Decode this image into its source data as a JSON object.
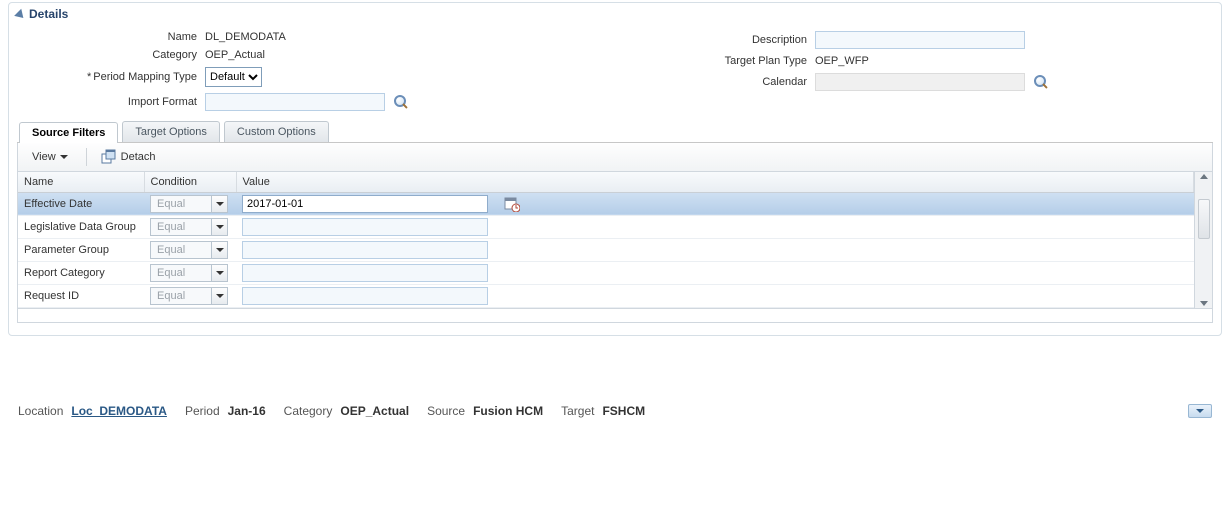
{
  "panel": {
    "title": "Details"
  },
  "form": {
    "left": {
      "name_label": "Name",
      "name_value": "DL_DEMODATA",
      "category_label": "Category",
      "category_value": "OEP_Actual",
      "period_mapping_label": "Period Mapping Type",
      "period_mapping_required": "*",
      "period_mapping_value": "Default",
      "import_format_label": "Import Format",
      "import_format_value": ""
    },
    "right": {
      "description_label": "Description",
      "description_value": "",
      "target_plan_type_label": "Target Plan Type",
      "target_plan_type_value": "OEP_WFP",
      "calendar_label": "Calendar",
      "calendar_value": ""
    }
  },
  "tabs": {
    "source_filters": "Source Filters",
    "target_options": "Target Options",
    "custom_options": "Custom Options"
  },
  "toolbar": {
    "view_label": "View",
    "detach_label": "Detach"
  },
  "grid": {
    "headers": {
      "name": "Name",
      "condition": "Condition",
      "value": "Value"
    },
    "rows": [
      {
        "name": "Effective Date",
        "condition": "Equal",
        "value": "2017-01-01",
        "selected": true,
        "has_date_picker": true
      },
      {
        "name": "Legislative Data Group",
        "condition": "Equal",
        "value": ""
      },
      {
        "name": "Parameter Group",
        "condition": "Equal",
        "value": ""
      },
      {
        "name": "Report Category",
        "condition": "Equal",
        "value": ""
      },
      {
        "name": "Request ID",
        "condition": "Equal",
        "value": ""
      }
    ]
  },
  "status": {
    "location_label": "Location",
    "location_value": "Loc_DEMODATA",
    "period_label": "Period",
    "period_value": "Jan-16",
    "category_label": "Category",
    "category_value": "OEP_Actual",
    "source_label": "Source",
    "source_value": "Fusion HCM",
    "target_label": "Target",
    "target_value": "FSHCM"
  }
}
